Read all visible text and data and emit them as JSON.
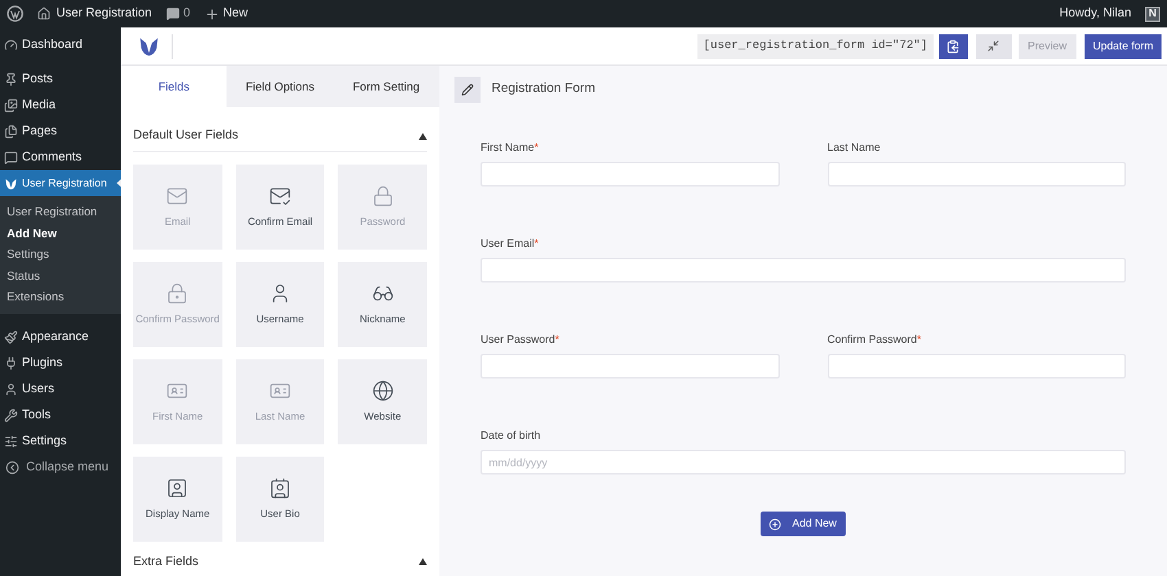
{
  "admin_bar": {
    "site": "User Registration",
    "comments": "0",
    "new": "New",
    "greeting": "Howdy, Nilan",
    "avatar": "N"
  },
  "sidebar": {
    "items": [
      {
        "label": "Dashboard",
        "selected": false
      },
      {
        "label": "Posts",
        "selected": false
      },
      {
        "label": "Media",
        "selected": false
      },
      {
        "label": "Pages",
        "selected": false
      },
      {
        "label": "Comments",
        "selected": false
      },
      {
        "label": "User Registration",
        "selected": true,
        "children": [
          {
            "label": "User Registration",
            "selected": false
          },
          {
            "label": "Add New",
            "selected": true
          },
          {
            "label": "Settings",
            "selected": false
          },
          {
            "label": "Status",
            "selected": false
          },
          {
            "label": "Extensions",
            "selected": false
          }
        ]
      },
      {
        "label": "Appearance",
        "selected": false
      },
      {
        "label": "Plugins",
        "selected": false
      },
      {
        "label": "Users",
        "selected": false
      },
      {
        "label": "Tools",
        "selected": false
      },
      {
        "label": "Settings",
        "selected": false
      }
    ],
    "collapse": "Collapse menu"
  },
  "toolbar": {
    "shortcode": "[user_registration_form id=\"72\"]",
    "preview": "Preview",
    "update": "Update form"
  },
  "tabs": [
    {
      "label": "Fields",
      "selected": true
    },
    {
      "label": "Field Options",
      "selected": false
    },
    {
      "label": "Form Setting",
      "selected": false
    }
  ],
  "sections": [
    {
      "title": "Default User Fields",
      "expanded": true,
      "fields": [
        {
          "label": "Email",
          "disabled": true
        },
        {
          "label": "Confirm Email",
          "disabled": false
        },
        {
          "label": "Password",
          "disabled": true
        },
        {
          "label": "Confirm Password",
          "disabled": true
        },
        {
          "label": "Username",
          "disabled": false
        },
        {
          "label": "Nickname",
          "disabled": false
        },
        {
          "label": "First Name",
          "disabled": true
        },
        {
          "label": "Last Name",
          "disabled": true
        },
        {
          "label": "Website",
          "disabled": false
        },
        {
          "label": "Display Name",
          "disabled": false
        },
        {
          "label": "User Bio",
          "disabled": false
        }
      ]
    },
    {
      "title": "Extra Fields",
      "expanded": true
    }
  ],
  "form": {
    "title": "Registration Form",
    "rows": [
      [
        {
          "label": "First Name",
          "required": true
        },
        {
          "label": "Last Name",
          "required": false
        }
      ],
      [
        {
          "label": "User Email",
          "required": true
        }
      ],
      [
        {
          "label": "User Password",
          "required": true
        },
        {
          "label": "Confirm Password",
          "required": true
        }
      ],
      [
        {
          "label": "Date of birth",
          "required": false,
          "placeholder": "mm/dd/yyyy"
        }
      ]
    ],
    "required_mark": "*",
    "add_button": "Add New"
  }
}
